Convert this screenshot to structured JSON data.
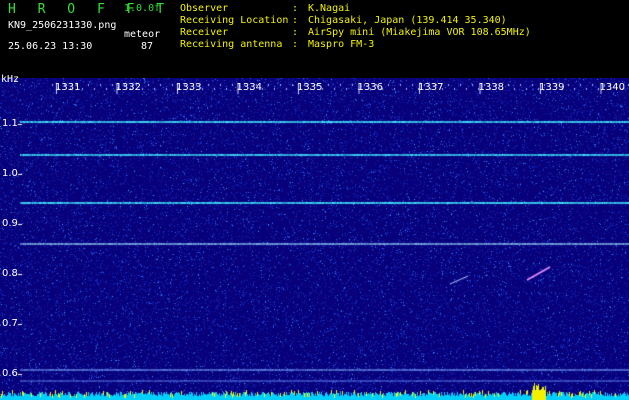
{
  "header": {
    "app_title": "H R O F F T",
    "version": "1.0.0f",
    "filename": "KN9_2506231330.png",
    "counter_label": "meteor",
    "datetime": "25.06.23 13:30",
    "count": "87",
    "meta": [
      {
        "key": "Observer",
        "value": "K.Nagai"
      },
      {
        "key": "Receiving Location",
        "value": "Chigasaki, Japan (139.414 35.340)"
      },
      {
        "key": "Receiver",
        "value": "AirSpy mini (Miakejima VOR 108.65MHz)"
      },
      {
        "key": "Receiving antenna",
        "value": "Maspro FM-3"
      }
    ],
    "colon": ":"
  },
  "spectrogram": {
    "y_unit": "kHz",
    "y_ticks": [
      "1.1",
      "1.0",
      "0.9",
      "0.8",
      "0.7",
      "0.6"
    ],
    "x_ticks": [
      "1331",
      "1332",
      "1333",
      "1334",
      "1335",
      "1336",
      "1337",
      "1338",
      "1339",
      "1340"
    ],
    "colors": {
      "background": "#07007a",
      "noise_dim": "#1a30c8",
      "noise_bright": "#3aa0ff",
      "carrier_line": "#40e8ff",
      "baseline": "#00d0ff",
      "peak": "#f2f200"
    }
  }
}
